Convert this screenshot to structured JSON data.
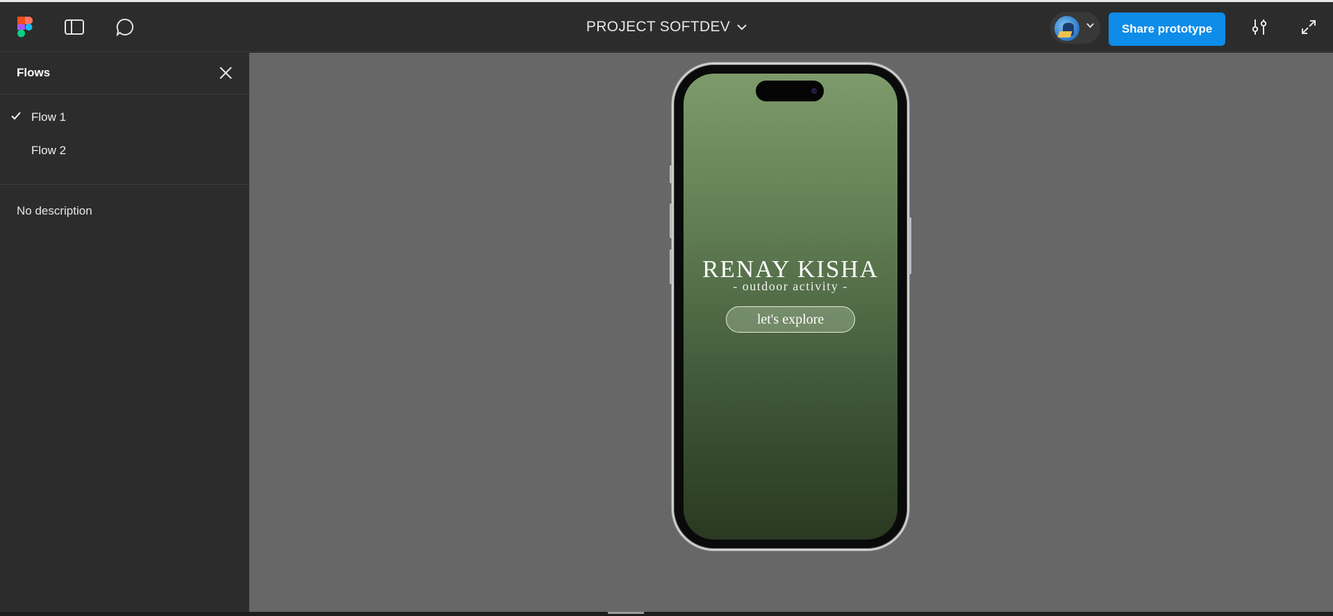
{
  "app": {
    "logo_icon": "figma-logo-icon",
    "file_title": "PROJECT SOFTDEV",
    "share_label": "Share prototype",
    "accent_color": "#0d8ce9"
  },
  "toolbar_icons": [
    "figma-logo-icon",
    "sidebar-toggle-icon",
    "comment-icon",
    "chevron-down-icon",
    "avatar",
    "settings-sliders-icon",
    "expand-icon"
  ],
  "sidebar": {
    "title": "Flows",
    "flows": [
      {
        "label": "Flow 1",
        "selected": true
      },
      {
        "label": "Flow 2",
        "selected": false
      }
    ],
    "description": "No description"
  },
  "prototype": {
    "brand": "RENAY KISHA",
    "tagline": "- outdoor activity -",
    "cta_label": "let's explore",
    "bg_top_color": "#7d9a6b",
    "bg_bottom_color": "#2a3922"
  }
}
